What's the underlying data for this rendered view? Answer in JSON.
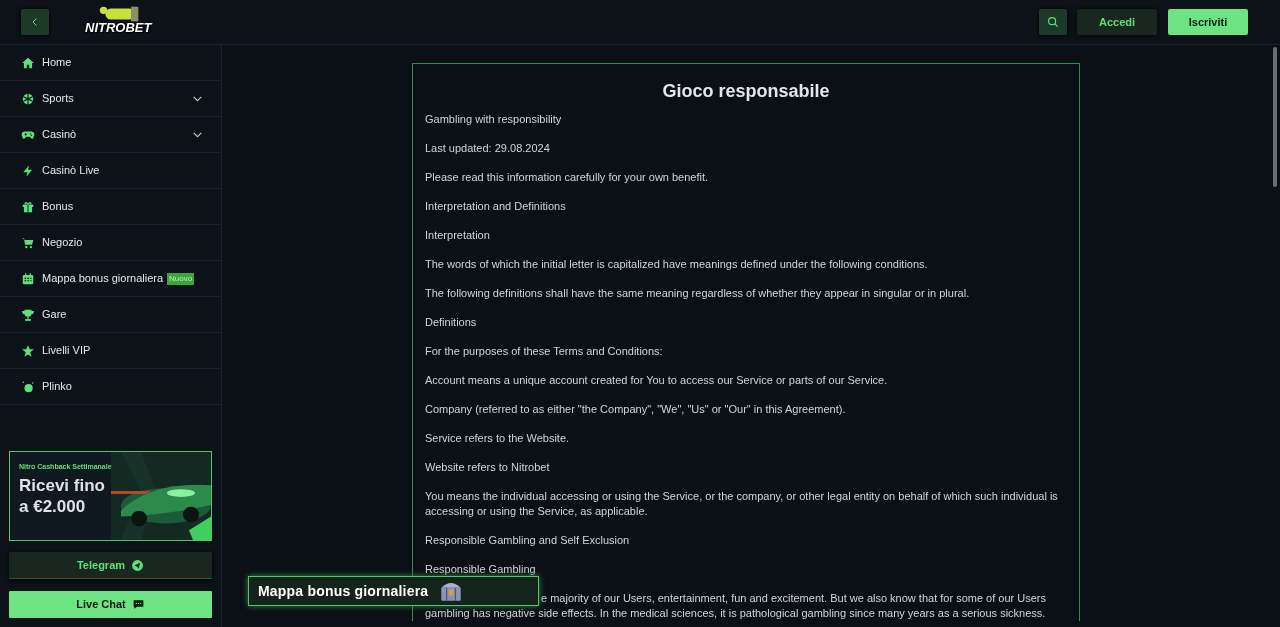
{
  "header": {
    "logo": "NITROBET",
    "buttons": [
      {
        "label": "Accedi",
        "kind": "secondary"
      },
      {
        "label": "Iscriviti",
        "kind": "primary"
      }
    ]
  },
  "sidebar": {
    "items": [
      {
        "label": "Home"
      },
      {
        "label": "Sports",
        "expanded": false
      },
      {
        "label": "Casinò",
        "expanded": false
      },
      {
        "label": "Casinò Live"
      },
      {
        "label": "Bonus"
      },
      {
        "label": "Negozio"
      },
      {
        "label": "Mappa bonus giornaliera",
        "badge": "Nuovo"
      },
      {
        "label": "Gare"
      },
      {
        "label": "Livelli VIP"
      },
      {
        "label": "Plinko"
      }
    ],
    "promo": {
      "eyebrow": "Nitro Cashback Settimanale",
      "headline": "Ricevi fino a €2.000",
      "kind": "picture"
    },
    "buttons": [
      {
        "label": "Telegram",
        "kind": "secondary"
      },
      {
        "label": "Live Chat",
        "kind": "primary"
      }
    ]
  },
  "content": {
    "title": "Gioco responsabile",
    "paragraphs": [
      "Gambling with responsibility",
      "Last updated: 29.08.2024",
      "Please read this information carefully for your own benefit.",
      "Interpretation and Definitions",
      "Interpretation",
      "The words of which the initial letter is capitalized have meanings defined under the following conditions.",
      "The following definitions shall have the same meaning regardless of whether they appear in singular or in plural.",
      "Definitions",
      "For the purposes of these Terms and Conditions:",
      "Account means a unique account created for You to access our Service or parts of our Service.",
      "Company (referred to as either \"the Company\", \"We\", \"Us\" or \"Our\" in this Agreement).",
      "Service refers to the Website.",
      "Website refers to Nitrobet",
      "You means the individual accessing or using the Service, or the company, or other legal entity on behalf of which such individual is accessing or using the Service, as applicable.",
      "Responsible Gambling and Self Exclusion",
      "Responsible Gambling"
    ],
    "partial_paragraph": [
      "e majority of our Users, entertainment, fun and excitement. But we also know that for some of our Users",
      "gambling has negative side effects. In the medical sciences, it is pathological gambling since many years as a serious sickness."
    ]
  },
  "floating_banner": {
    "label": "Mappa bonus giornaliera"
  }
}
